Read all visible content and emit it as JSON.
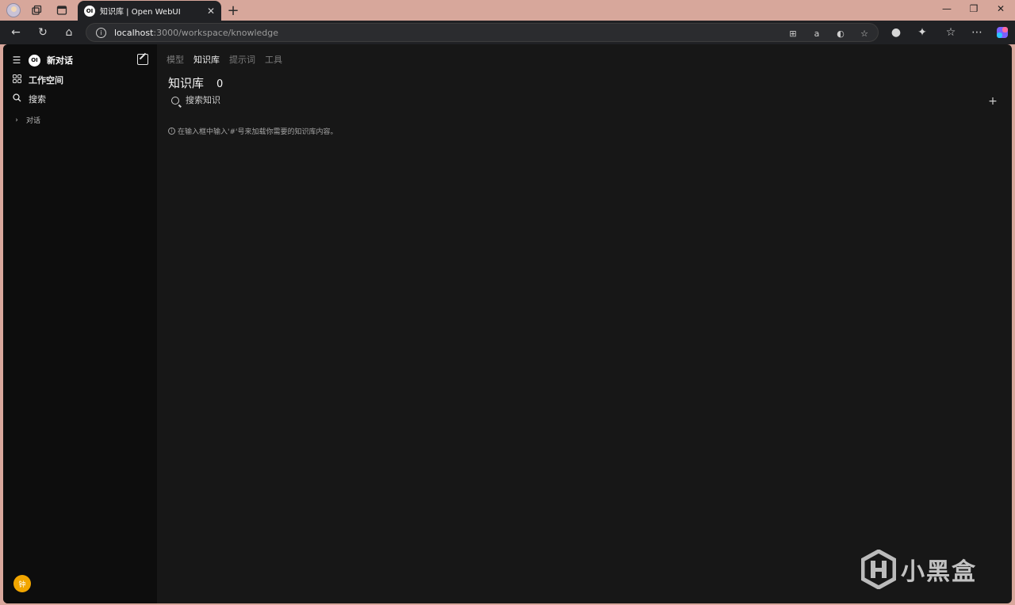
{
  "browser": {
    "tab_title": "知识库 | Open WebUI",
    "tab_favicon_text": "OI",
    "url_host": "localhost",
    "url_path": ":3000/workspace/knowledge"
  },
  "sidebar": {
    "logo_text": "OI",
    "new_chat": "新对话",
    "workspace": "工作空间",
    "search": "搜索",
    "folder": "对话",
    "avatar_initial": "钟"
  },
  "main": {
    "nav": [
      "模型",
      "知识库",
      "提示词",
      "工具"
    ],
    "active_nav": "知识库",
    "title": "知识库",
    "count": "0",
    "search_placeholder": "搜索知识",
    "add": "+",
    "hint": "在输入框中输入'#'号来加载你需要的知识库内容。"
  },
  "watermark": {
    "text": "小黑盒"
  },
  "colors": {
    "chrome_frame": "#d7a79b",
    "app_bg": "#171717",
    "sidebar_bg": "#0d0d0d",
    "avatar_bg": "#f2a600"
  }
}
